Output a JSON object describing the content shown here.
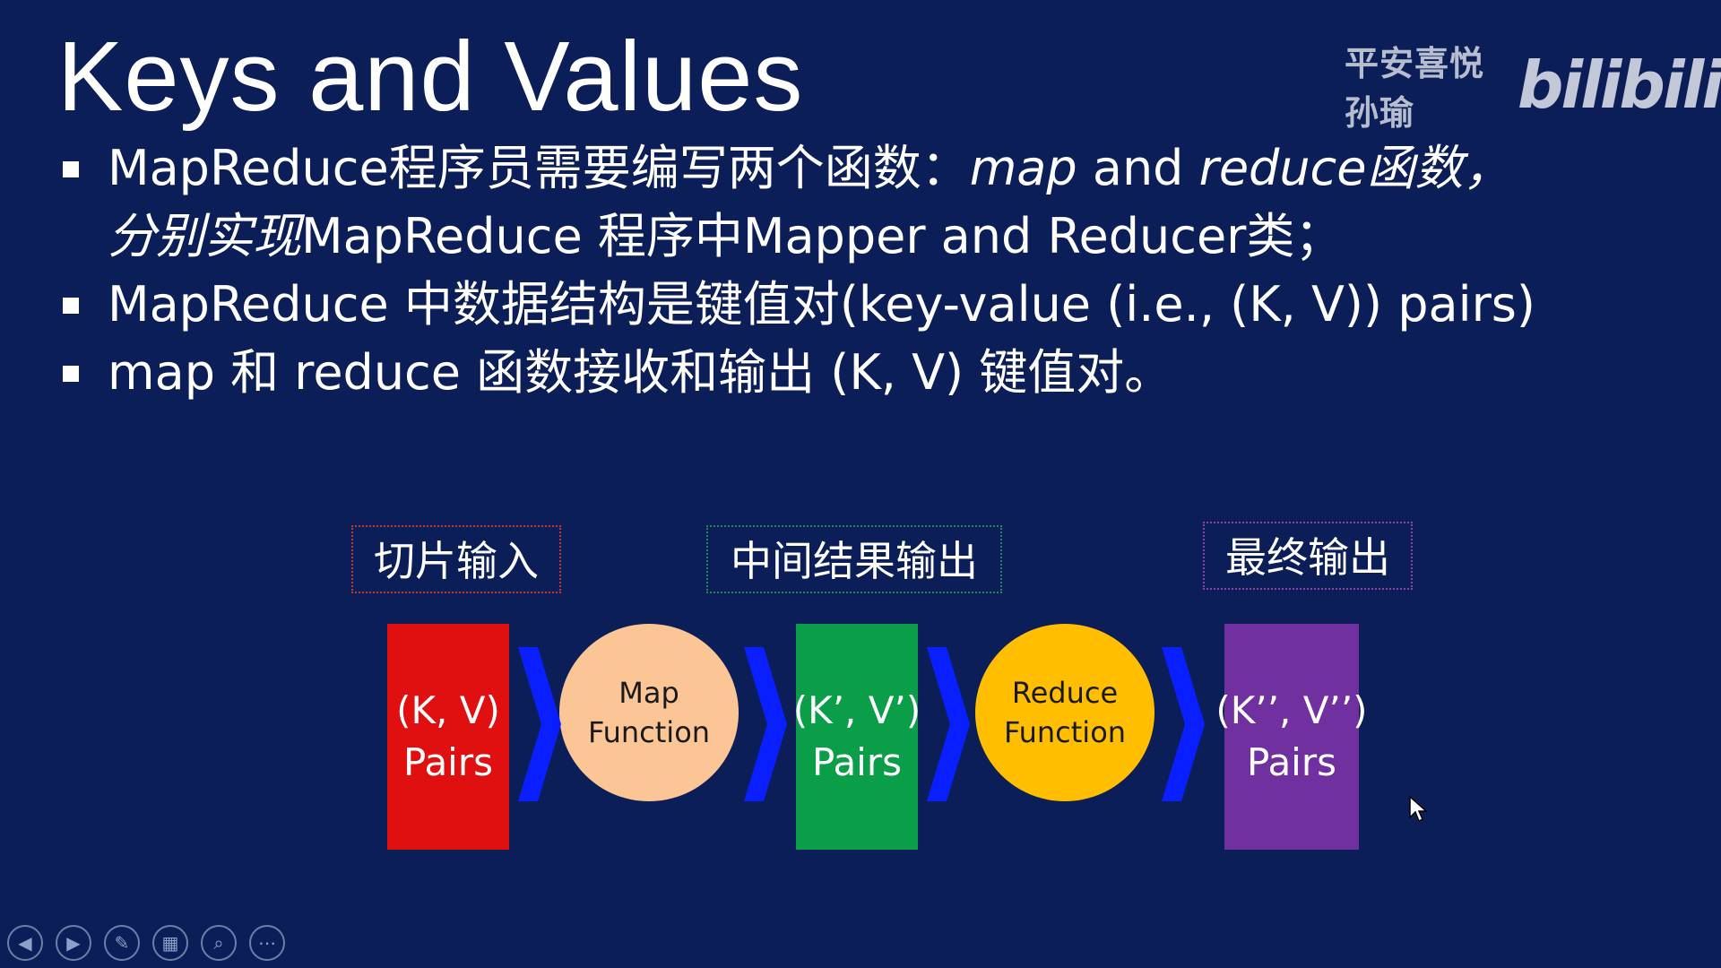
{
  "slide": {
    "title": "Keys and Values",
    "watermark": {
      "user": "平安喜悦孙瑜",
      "logo": "bilibili"
    },
    "bullets": [
      {
        "parts": [
          {
            "text": "MapReduce程序员需要编写两个函数：",
            "italic": false
          },
          {
            "text": "map",
            "italic": true
          },
          {
            "text": " and ",
            "italic": false
          },
          {
            "text": "reduce函数，",
            "italic": true
          }
        ],
        "continuation": [
          {
            "text": "分别实现",
            "italic": true
          },
          {
            "text": "MapReduce 程序中Mapper and Reducer类；",
            "italic": false
          }
        ]
      },
      {
        "parts": [
          {
            "text": "MapReduce 中数据结构是键值对(key-value (i.e., (K, V)) pairs)",
            "italic": false
          }
        ]
      },
      {
        "parts": [
          {
            "text": "map 和 reduce 函数接收和输出 (K, V) 键值对。",
            "italic": false
          }
        ]
      }
    ]
  },
  "diagram": {
    "labels": {
      "input": "切片输入",
      "intermediate": "中间结果输出",
      "final": "最终输出"
    },
    "pairs": {
      "input": {
        "line1": "(K, V)",
        "line2": "Pairs"
      },
      "intermediate": {
        "line1": "(K’, V’)",
        "line2": "Pairs"
      },
      "final": {
        "line1": "(K’’, V’’)",
        "line2": "Pairs"
      }
    },
    "functions": {
      "map": {
        "line1": "Map",
        "line2": "Function"
      },
      "reduce": {
        "line1": "Reduce",
        "line2": "Function"
      }
    },
    "colors": {
      "input_pair": "#e01010",
      "intermediate_pair": "#0a9e48",
      "final_pair": "#7030a0",
      "map_function": "#fcc595",
      "reduce_function": "#ffbf00",
      "chevron": "#0a1fff"
    }
  },
  "controls": [
    {
      "name": "previous-slide",
      "icon": "arrow-left-icon",
      "glyph": "◀"
    },
    {
      "name": "next-slide",
      "icon": "arrow-right-icon",
      "glyph": "▶"
    },
    {
      "name": "pen-tool",
      "icon": "pen-icon",
      "glyph": "✎"
    },
    {
      "name": "slide-view",
      "icon": "grid-icon",
      "glyph": "▦"
    },
    {
      "name": "zoom",
      "icon": "magnifier-icon",
      "glyph": "⌕"
    },
    {
      "name": "more-options",
      "icon": "ellipsis-icon",
      "glyph": "⋯"
    }
  ]
}
